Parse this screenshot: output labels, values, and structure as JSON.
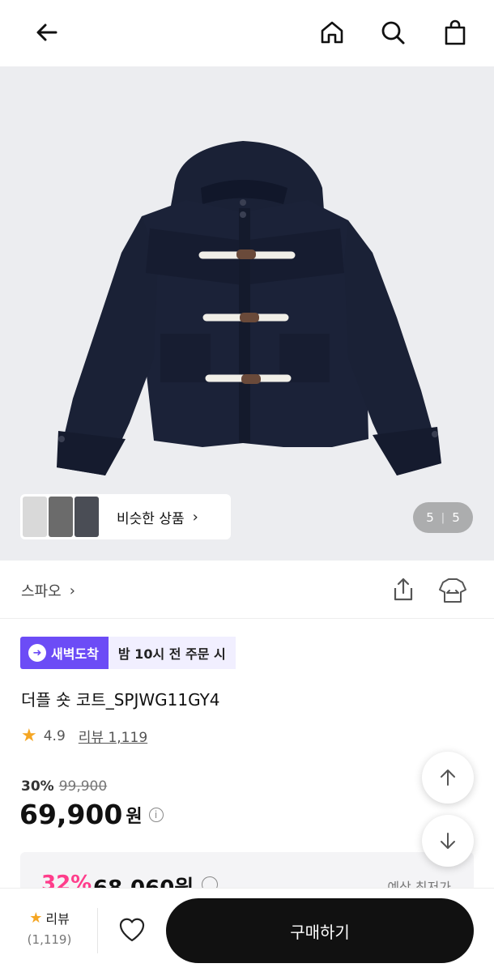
{
  "header": {
    "back_icon": "back-arrow-icon",
    "home_icon": "home-icon",
    "search_icon": "search-icon",
    "cart_icon": "shopping-bag-icon"
  },
  "gallery": {
    "similar_label": "비슷한 상품",
    "current": "5",
    "separator": "|",
    "total": "5"
  },
  "brand": {
    "name": "스파오",
    "share_icon": "share-icon",
    "fit_icon": "size-fit-icon"
  },
  "delivery": {
    "badge": "새벽도착",
    "condition": "밤 10시 전 주문 시"
  },
  "product": {
    "title": "더플 숏 코트_SPJWG11GY4",
    "rating": "4.9",
    "review_label": "리뷰 1,119",
    "discount_rate": "30%",
    "original_price": "99,900",
    "price": "69,900",
    "currency": "원"
  },
  "coupon": {
    "rate": "32%",
    "price": "68,060원",
    "link": "예상 최저가"
  },
  "bottom": {
    "review_label": "리뷰",
    "review_count": "(1,119)",
    "buy_label": "구매하기"
  },
  "colors": {
    "accent_purple": "#6c4cf6",
    "coupon_pink": "#ff3d8b",
    "star": "#f5a623"
  }
}
